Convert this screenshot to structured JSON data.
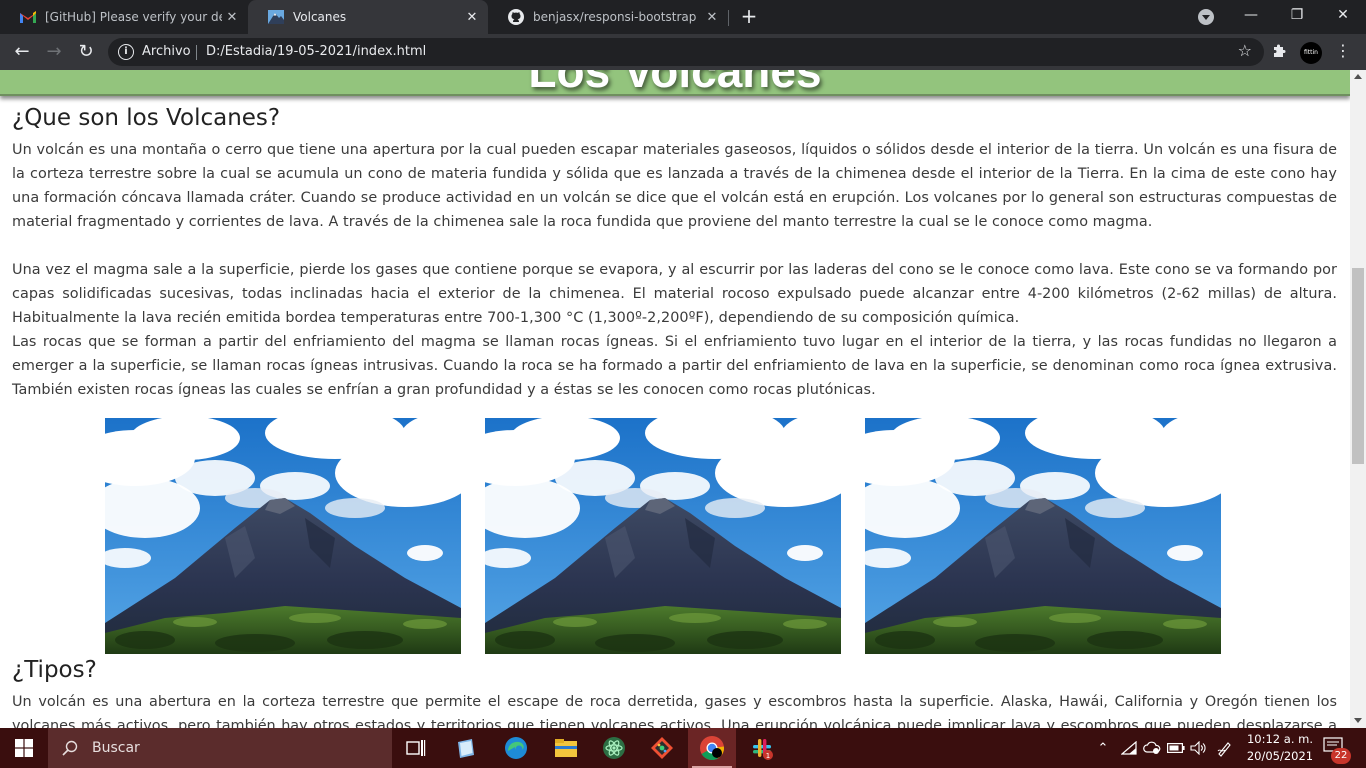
{
  "browser": {
    "tabs": [
      {
        "title": "[GitHub] Please verify your device",
        "icon": "gmail-icon",
        "active": false
      },
      {
        "title": "Volcanes",
        "icon": "mountain-icon",
        "active": true
      },
      {
        "title": "benjasx/responsi-bootstrap",
        "icon": "github-icon",
        "active": false
      }
    ],
    "address": {
      "scheme_label": "Archivo",
      "url": "D:/Estadia/19-05-2021/index.html"
    },
    "profile_text": "fittin"
  },
  "page": {
    "header_title": "Los Volcanes",
    "section1": {
      "heading": "¿Que son los Volcanes?",
      "paragraph1": "Un volcán es una montaña o cerro que tiene una apertura por la cual pueden escapar materiales gaseosos, líquidos o sólidos desde el interior de la tierra. Un volcán es una fisura de la corteza terrestre sobre la cual se acumula un cono de materia fundida y sólida que es lanzada a través de la chimenea desde el interior de la Tierra. En la cima de este cono hay una formación cóncava llamada cráter. Cuando se produce actividad en un volcán se dice que el volcán está en erupción. Los volcanes por lo general son estructuras compuestas de material fragmentado y corrientes de lava. A través de la chimenea sale la roca fundida que proviene del manto terrestre la cual se le conoce como magma.",
      "paragraph2": "Una vez el magma sale a la superficie, pierde los gases que contiene porque se evapora, y al escurrir por las laderas del cono se le conoce como lava. Este cono se va formando por capas solidificadas sucesivas, todas inclinadas hacia el exterior de la chimenea. El material rocoso expulsado puede alcanzar entre 4-200 kilómetros (2-62 millas) de altura. Habitualmente la lava recién emitida bordea temperaturas entre 700-1,300 °C (1,300º-2,200ºF), dependiendo de su composición química.",
      "paragraph3": "Las rocas que se forman a partir del enfriamiento del magma se llaman rocas ígneas. Si el enfriamiento tuvo lugar en el interior de la tierra, y las rocas fundidas no llegaron a emerger a la superficie, se llaman rocas ígneas intrusivas. Cuando la roca se ha formado a partir del enfriamiento de lava en la superficie, se denominan como roca ígnea extrusiva. También existen rocas ígneas las cuales se enfrían a gran profundidad y a éstas se les conocen como rocas plutónicas."
    },
    "gallery": [
      {
        "image": "volcano-photo"
      },
      {
        "image": "volcano-photo"
      },
      {
        "image": "volcano-photo"
      }
    ],
    "section2": {
      "heading": "¿Tipos?",
      "paragraph1": "Un volcán es una abertura en la corteza terrestre que permite el escape de roca derretida, gases y escombros hasta la superficie. Alaska, Hawái, California y Oregón tienen los volcanes más activos, pero también hay otros estados y territorios que tienen volcanes activos. Una erupción volcánica puede implicar lava y escombros que pueden desplazarse a una velocidad de"
    }
  },
  "taskbar": {
    "search_placeholder": "Buscar",
    "clock_time": "10:12 a. m.",
    "clock_date": "20/05/2021",
    "notification_count": "22",
    "slack_badge": "1"
  },
  "colors": {
    "header_green": "#93c47d",
    "taskbar": "#3a0e0e",
    "chrome_dark": "#202124"
  }
}
